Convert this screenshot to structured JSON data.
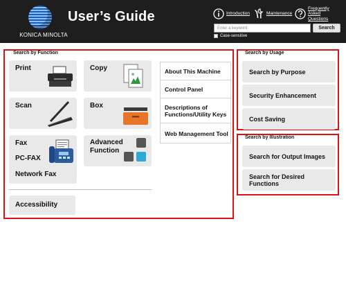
{
  "header": {
    "brand": "KONICA MINOLTA",
    "title": "User’s Guide",
    "links": {
      "introduction": "Introduction",
      "maintenance": "Maintenance",
      "faq": "Frequently Asked Questions"
    },
    "search": {
      "placeholder": "Enter a keyword",
      "button_label": "Search",
      "case_sensitive_label": "Case-sensitive"
    }
  },
  "search_by_function": {
    "title": "Search by Function",
    "buttons": {
      "print": "Print",
      "copy": "Copy",
      "scan": "Scan",
      "box": "Box",
      "fax": "Fax",
      "pc_fax": "PC-FAX",
      "network_fax": "Network Fax",
      "advanced_function": "Advanced Function",
      "accessibility": "Accessibility"
    },
    "list": [
      "About This Machine",
      "Control Panel",
      "Descriptions of Functions/Utility Keys",
      "Web Management Tool"
    ]
  },
  "search_by_usage": {
    "title": "Search by Usage",
    "buttons": [
      "Search by Purpose",
      "Security Enhancement",
      "Cost Saving"
    ]
  },
  "search_by_illustration": {
    "title": "Search by Illustration",
    "buttons": [
      "Search for Output Images",
      "Search for Desired Functions"
    ]
  },
  "colors": {
    "header_bg": "#1e1e1e",
    "panel_border": "#e01010",
    "button_bg": "#e9e9e9",
    "accent_orange": "#e8762a",
    "accent_blue": "#2ea9d6",
    "accent_green": "#2e9a3e"
  },
  "icons": [
    "printer-icon",
    "copy-icon",
    "scanner-icon",
    "box-icon",
    "fax-icon",
    "advanced-function-icon",
    "info-icon",
    "tools-icon",
    "question-icon"
  ]
}
